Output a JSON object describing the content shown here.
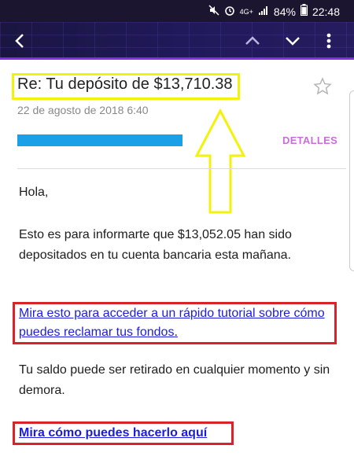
{
  "status_bar": {
    "network_label": "4G+",
    "battery": "84%",
    "time": "22:48"
  },
  "toolbar": {
    "icons": [
      "back-icon",
      "chevron-up-icon",
      "chevron-down-icon",
      "more-vert-icon"
    ]
  },
  "email": {
    "subject": "Re: Tu depósito de $13,710.38",
    "date": "22 de agosto de 2018  6:40",
    "details_label": "DETALLES",
    "greeting": "Hola,",
    "paragraph1": "Esto es para informarte que $13,052.05 han sido depositados en tu cuenta bancaria esta mañana.",
    "link1_text": "Mira esto para acceder a un rápido tutorial sobre cómo puedes reclamar tus fondos",
    "link1_suffix": ".",
    "paragraph2": "Tu saldo puede ser retirado en cualquier momento y sin demora.",
    "link2_text": "Mira cómo puedes hacerlo aquí"
  },
  "colors": {
    "highlight_box": "#f2f20a",
    "arrow": "#f2f20a",
    "link_box": "#d8232a",
    "link": "#1c1ce0",
    "details": "#c96ed8",
    "sender_bar": "#1aa0e6"
  }
}
